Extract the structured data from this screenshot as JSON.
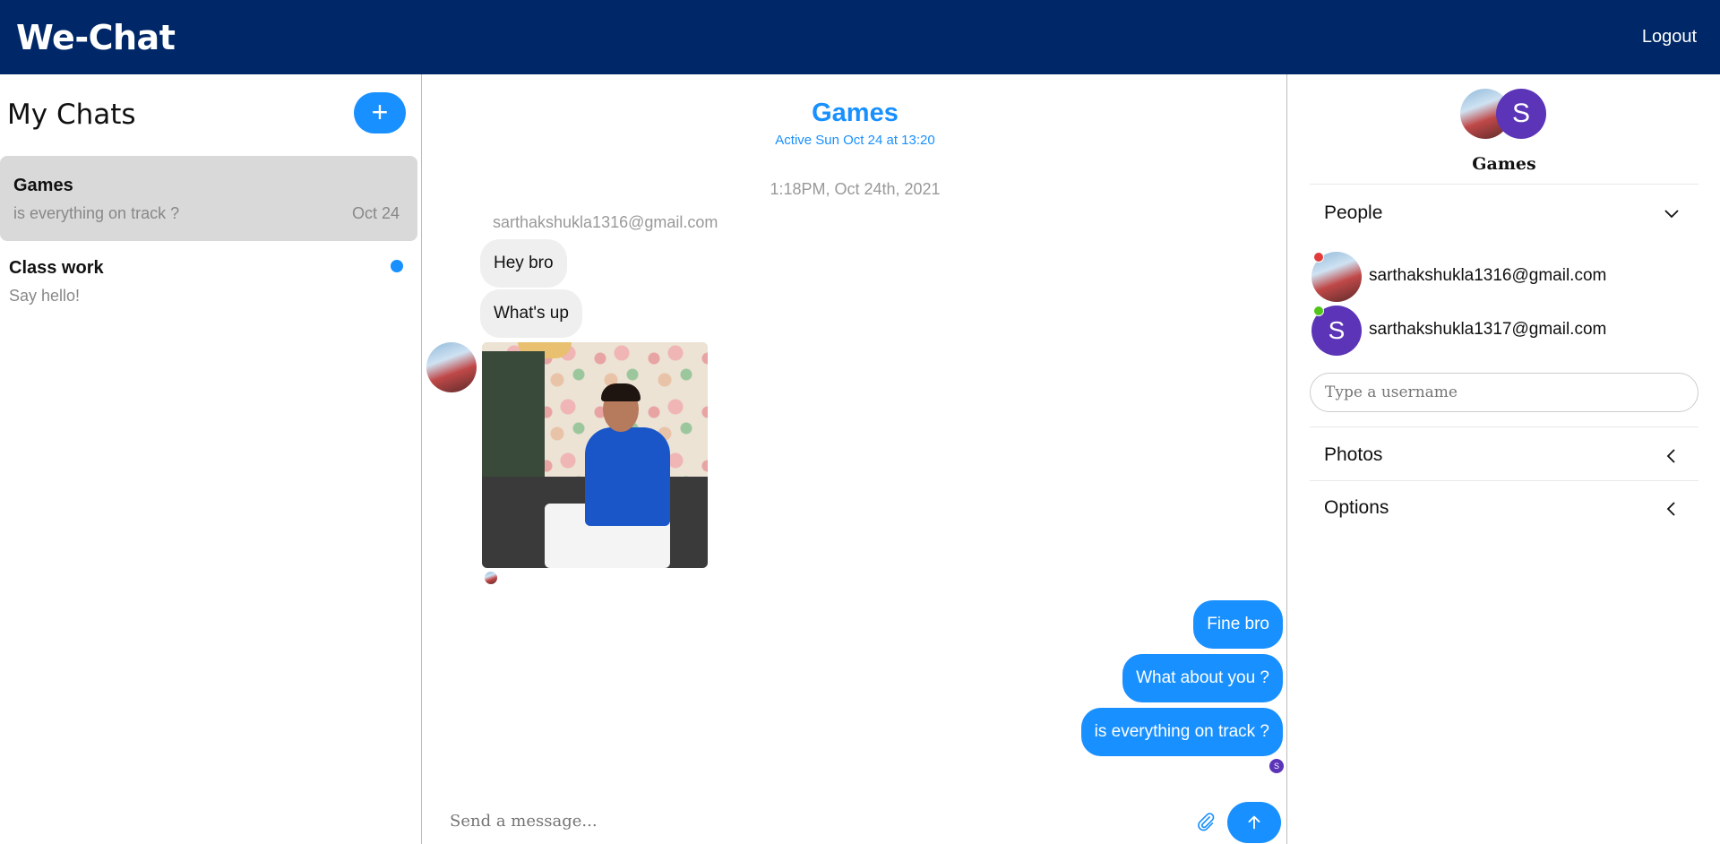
{
  "app": {
    "brand": "We-Chat",
    "logout_label": "Logout"
  },
  "sidebar": {
    "title": "My Chats",
    "new_chat_symbol": "+",
    "chats": [
      {
        "title": "Games",
        "preview": "is everything on track ?",
        "date": "Oct 24",
        "active": true,
        "unread": false
      },
      {
        "title": "Class work",
        "preview": "Say hello!",
        "date": "",
        "active": false,
        "unread": true
      }
    ]
  },
  "feed": {
    "title": "Games",
    "subtitle": "Active Sun Oct 24 at 13:20",
    "timestamp": "1:18PM, Oct 24th, 2021",
    "sender": "sarthakshukla1316@gmail.com",
    "incoming": [
      "Hey bro",
      "What's up"
    ],
    "outgoing": [
      "Fine bro",
      "What about you ?",
      "is everything on track ?"
    ],
    "outgoing_reader_initial": "S",
    "input_placeholder": "Send a message..."
  },
  "settings": {
    "title": "Games",
    "avatar_initial": "S",
    "people_label": "People",
    "people": [
      {
        "email": "sarthakshukla1316@gmail.com",
        "status_color": "#e23b3b",
        "initial": ""
      },
      {
        "email": "sarthakshukla1317@gmail.com",
        "status_color": "#52c41a",
        "initial": "S"
      }
    ],
    "username_placeholder": "Type a username",
    "photos_label": "Photos",
    "options_label": "Options"
  },
  "colors": {
    "topbar": "#002868",
    "accent": "#1890ff",
    "avatar_purple": "#5b34b8"
  }
}
